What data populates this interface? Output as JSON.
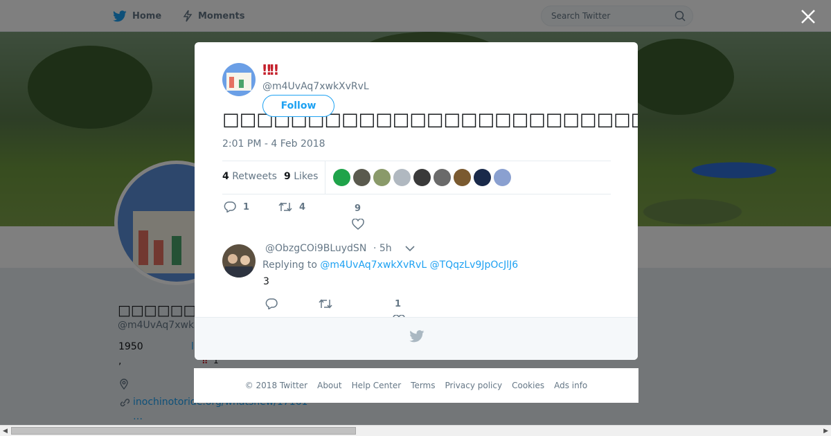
{
  "nav": {
    "home_label": "Home",
    "moments_label": "Moments",
    "search_placeholder": "Search Twitter"
  },
  "profile": {
    "name": "□□□□□□□□□□□□□□□□",
    "handle": "@m4UvAq7xwk",
    "bio_year": "1950",
    "bio_link": "l",
    "bio_comma": ",",
    "bio_emoji": "‼",
    "bio_emoji_count": "1",
    "url": "inochinotoride.org/whatsnew/17161",
    "more": "…"
  },
  "tweet": {
    "author_name": "‼‼",
    "author_handle": "@m4UvAq7xwkXvRvL",
    "follow_label": "Follow",
    "text": "□□□□□□□□□□□□□□□□□□□□□□□□□□□□□□□□□□□□□□□□□□□□□□□□□□□□□□□□□□□□□□□□□□□□□□□□□□□□",
    "time": "2:01 PM - 4 Feb 2018",
    "retweets_count": "4",
    "retweets_label": "Retweets",
    "likes_count": "9",
    "likes_label": "Likes",
    "action_reply_count": "1",
    "action_retweet_count": "4",
    "action_like_count": "9",
    "liker_colors": [
      "#1fa34a",
      "#5a5a4e",
      "#8a9a6a",
      "#b0b8c0",
      "#3a3a3a",
      "#6a6a6a",
      "#7a5a30",
      "#1a2a4a",
      "#8aa0d0"
    ]
  },
  "reply": {
    "handle": "@ObzgCOi9BLuydSN",
    "time": "· 5h",
    "replying_prefix": "Replying to",
    "replying_to_1": "@m4UvAq7xwkXvRvL",
    "replying_to_2": "@TQqzLv9JpOcJlJ6",
    "text": "3",
    "like_count": "1"
  },
  "footer": {
    "copyright": "© 2018 Twitter",
    "about": "About",
    "help_center": "Help Center",
    "terms": "Terms",
    "privacy": "Privacy policy",
    "cookies": "Cookies",
    "ads_info": "Ads info"
  },
  "colors": {
    "accent": "#1da1f2",
    "name_red": "#c4202b",
    "muted": "#657786"
  }
}
